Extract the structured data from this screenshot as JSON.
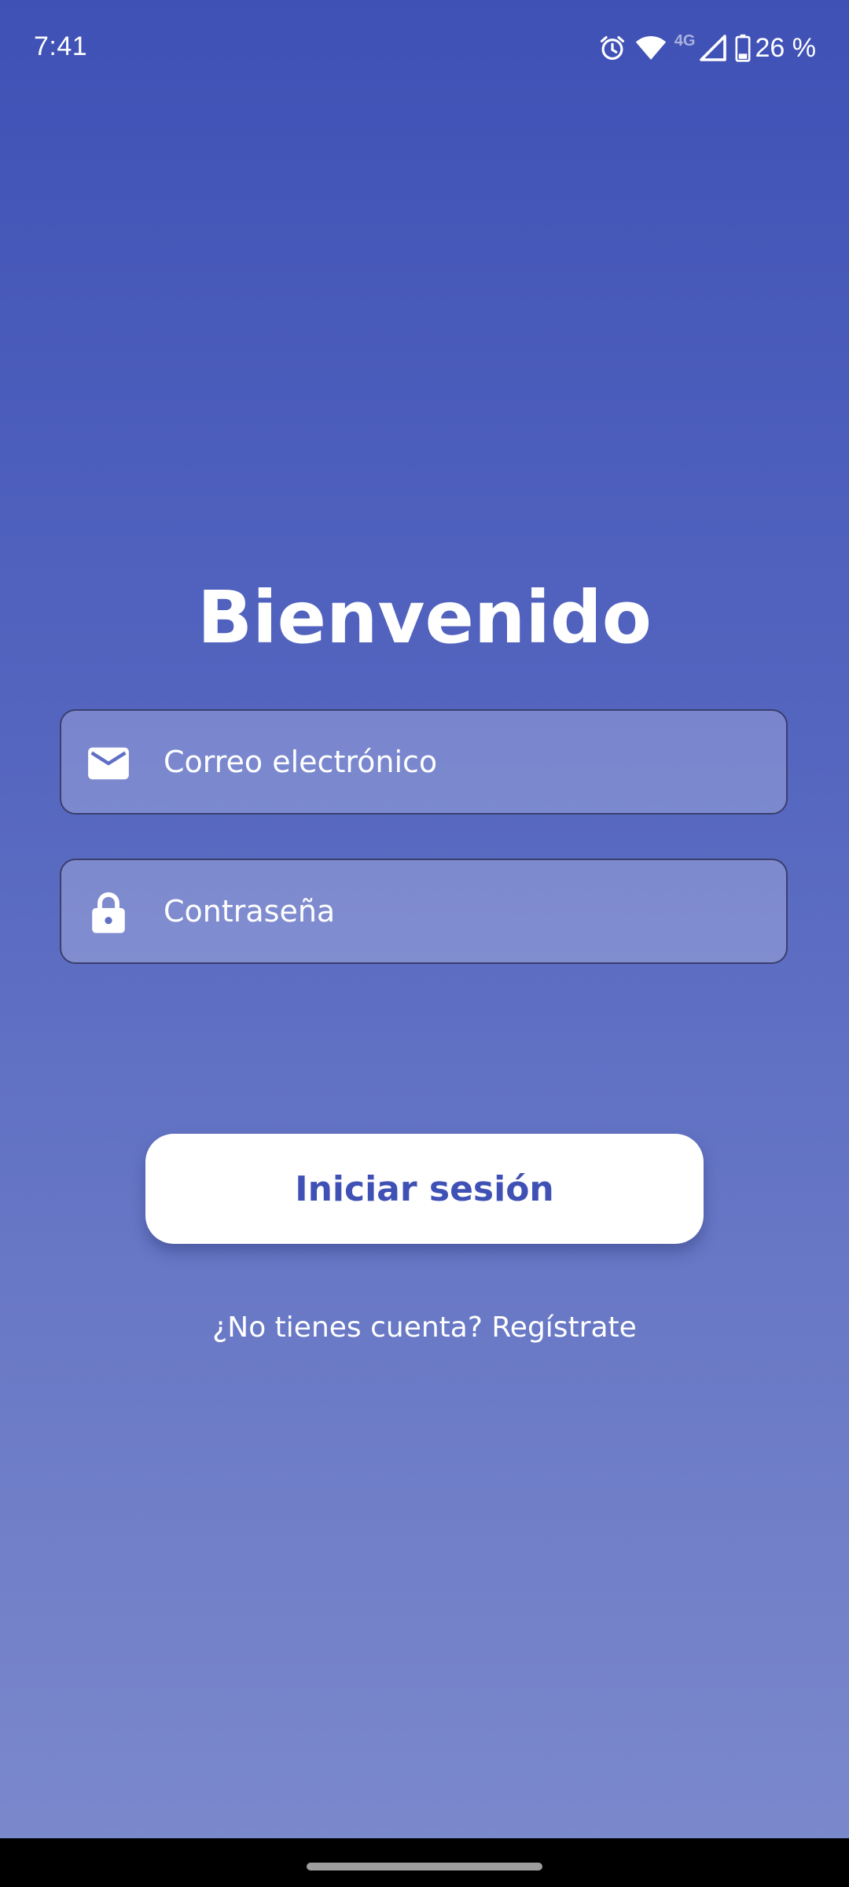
{
  "status_bar": {
    "time": "7:41",
    "network": "4G",
    "battery_percent": "26 %",
    "icons": [
      "alarm-icon",
      "wifi-icon",
      "cell-signal-icon",
      "battery-icon"
    ]
  },
  "login": {
    "title": "Bienvenido",
    "email": {
      "placeholder": "Correo electrónico",
      "value": "",
      "icon": "mail-icon"
    },
    "password": {
      "placeholder": "Contraseña",
      "value": "",
      "icon": "lock-icon"
    },
    "submit_label": "Iniciar sesión",
    "register_link": "¿No tienes cuenta? Regístrate"
  },
  "colors": {
    "background_top": "#3f51b5",
    "background_bottom": "#7c89cc",
    "accent": "#3f51b5",
    "button_background": "#ffffff",
    "field_border": "#3a3f6e"
  }
}
